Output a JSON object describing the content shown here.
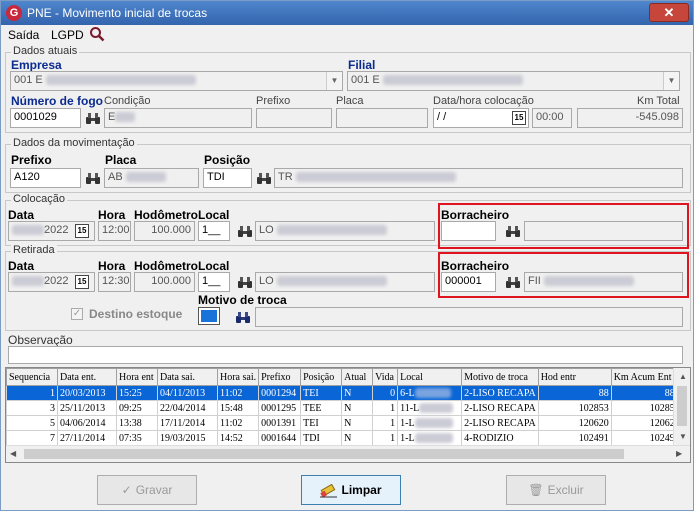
{
  "window": {
    "title": "PNE - Movimento inicial de trocas",
    "close_glyph": "✕",
    "logo_letter": "G"
  },
  "menu": {
    "items": [
      "Saída",
      "LGPD"
    ],
    "search_icon": "search-icon"
  },
  "dados_atuais": {
    "legend": "Dados atuais",
    "empresa_label": "Empresa",
    "empresa_value": "001 E",
    "filial_label": "Filial",
    "filial_value": "001 E",
    "numero_fogo_label": "Número de fogo",
    "numero_fogo_value": "0001029",
    "condicao_label": "Condição",
    "condicao_value": "E",
    "prefixo_label": "Prefixo",
    "placa_label": "Placa",
    "data_hora_label": "Data/hora colocação",
    "data_value": " /  /",
    "hora_value": "00:00",
    "km_total_label": "Km Total",
    "km_total_value": "-545.098"
  },
  "dados_movimentacao": {
    "legend": "Dados da movimentação",
    "prefixo_label": "Prefixo",
    "prefixo_value": "A120",
    "placa_label": "Placa",
    "placa_value": "AB",
    "posicao_label": "Posição",
    "posicao_value": "TDI",
    "posicao_desc": "TR"
  },
  "colocacao": {
    "legend": "Colocação",
    "data_label": "Data",
    "data_value": "2022",
    "hora_label": "Hora",
    "hora_value": "12:00",
    "hodometro_label": "Hodômetro",
    "hodometro_value": "100.000",
    "local_label": "Local",
    "local_value": "1__",
    "local_desc": "LO",
    "borracheiro_label": "Borracheiro",
    "borracheiro_value": ""
  },
  "retirada": {
    "legend": "Retirada",
    "data_label": "Data",
    "data_value": "2022",
    "hora_label": "Hora",
    "hora_value": "12:30",
    "hodometro_label": "Hodômetro",
    "hodometro_value": "100.000",
    "local_label": "Local",
    "local_value": "1__",
    "local_desc": "LO",
    "borracheiro_label": "Borracheiro",
    "borracheiro_value": "000001",
    "borracheiro_desc": "FII",
    "destino_label": "Destino estoque",
    "destino_checked": "✓",
    "motivo_label": "Motivo de troca"
  },
  "observacao": {
    "label": "Observação",
    "value": ""
  },
  "grid": {
    "columns": [
      "Sequencia",
      "Data ent.",
      "Hora ent",
      "Data sai.",
      "Hora sai.",
      "Prefixo",
      "Posição",
      "Atual",
      "Vida",
      "Local",
      "Motivo de troca",
      "Hod entr",
      "Km Acum Ent"
    ],
    "rows": [
      [
        "1",
        "20/03/2013",
        "15:25",
        "04/11/2013",
        "11:02",
        "0001294",
        "TEI",
        "N",
        "0",
        "6-L",
        "2-LISO RECAPA",
        "88",
        "88"
      ],
      [
        "3",
        "25/11/2013",
        "09:25",
        "22/04/2014",
        "15:48",
        "0001295",
        "TEE",
        "N",
        "1",
        "11-L",
        "2-LISO RECAPA",
        "102853",
        "10285"
      ],
      [
        "5",
        "04/06/2014",
        "13:38",
        "17/11/2014",
        "11:02",
        "0001391",
        "TEI",
        "N",
        "1",
        "1-L",
        "2-LISO RECAPA",
        "120620",
        "12062"
      ],
      [
        "7",
        "27/11/2014",
        "07:35",
        "19/03/2015",
        "14:52",
        "0001644",
        "TDI",
        "N",
        "1",
        "1-L",
        "4-RODIZIO",
        "102491",
        "10249"
      ]
    ]
  },
  "buttons": {
    "gravar": "Gravar",
    "limpar": "Limpar",
    "excluir": "Excluir"
  },
  "colors": {
    "title_bar": "#3b6fb6",
    "highlight": "#e0141e",
    "selected_row": "#0a66d6",
    "label_blue": "#0a2b8f"
  }
}
